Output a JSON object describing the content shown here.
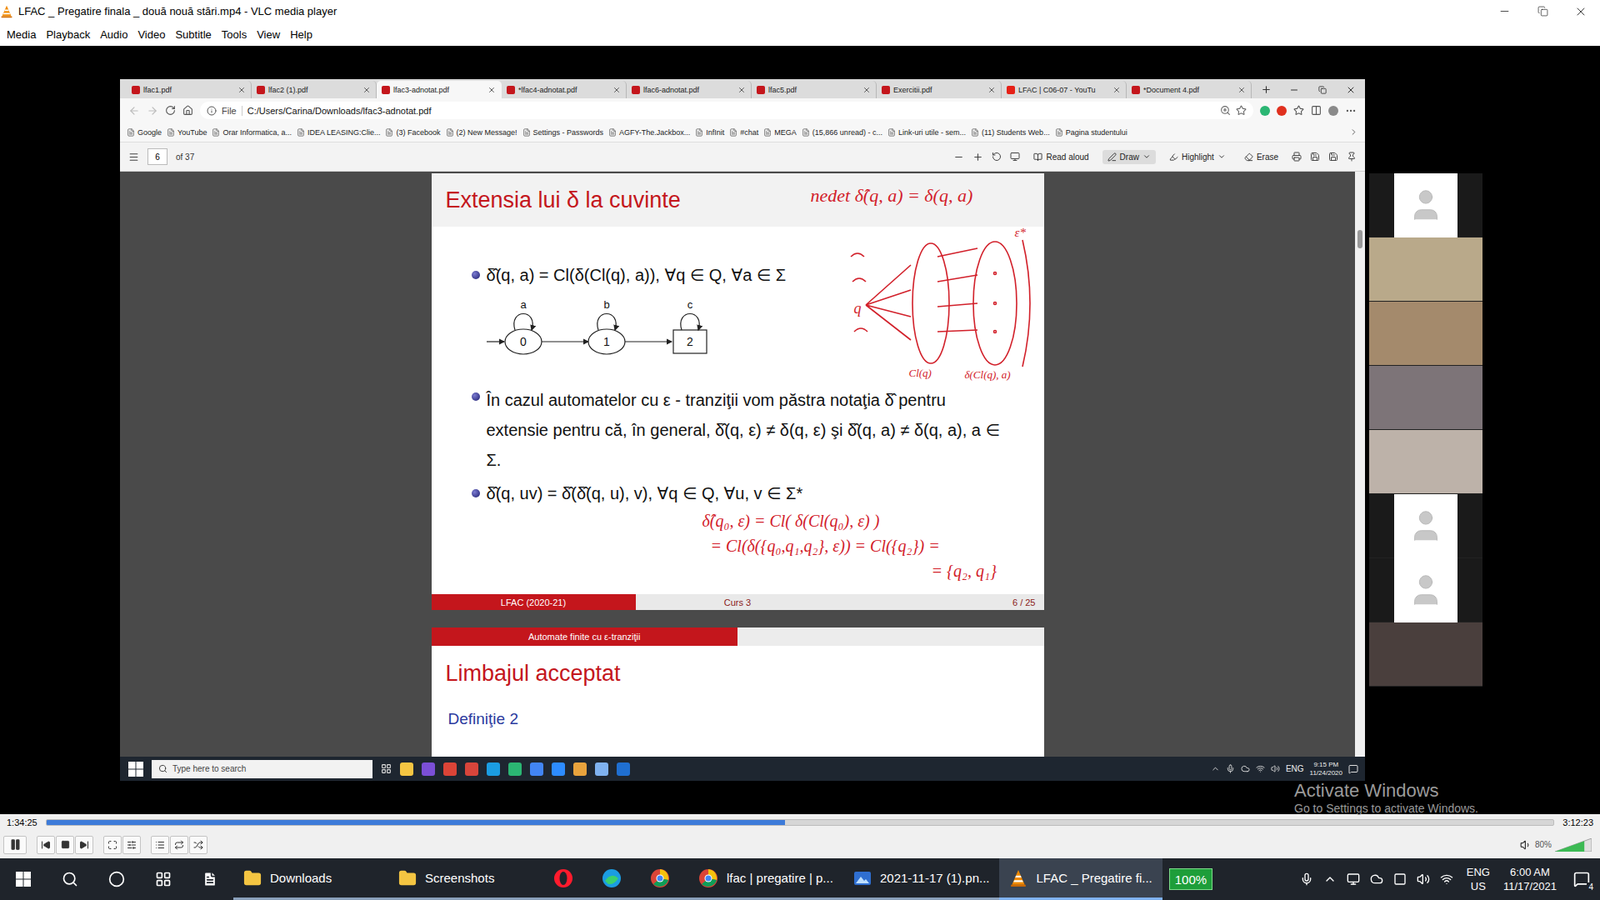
{
  "vlc": {
    "title": "LFAC _ Pregatire finala _ două nouă stări.mp4 - VLC media player",
    "menu": [
      "Media",
      "Playback",
      "Audio",
      "Video",
      "Subtitle",
      "Tools",
      "View",
      "Help"
    ]
  },
  "browser": {
    "tabs": [
      {
        "label": "lfac1.pdf",
        "kind": "pdf",
        "selected": false
      },
      {
        "label": "lfac2 (1).pdf",
        "kind": "pdf",
        "selected": false
      },
      {
        "label": "lfac3-adnotat.pdf",
        "kind": "pdf",
        "selected": true
      },
      {
        "label": "*lfac4-adnotat.pdf",
        "kind": "pdf",
        "selected": false
      },
      {
        "label": "lfac6-adnotat.pdf",
        "kind": "pdf",
        "selected": false
      },
      {
        "label": "lfac5.pdf",
        "kind": "pdf",
        "selected": false
      },
      {
        "label": "Exercitii.pdf",
        "kind": "pdf",
        "selected": false
      },
      {
        "label": "LFAC | C06-07 - YouTu",
        "kind": "youtube",
        "selected": false
      },
      {
        "label": "*Document 4.pdf",
        "kind": "pdf",
        "selected": false
      }
    ],
    "address": {
      "scheme": "File",
      "path": "C:/Users/Carina/Downloads/lfac3-adnotat.pdf"
    },
    "bookmarks": [
      "Google",
      "YouTube",
      "Orar Informatica, a...",
      "IDEA LEASING:Clie...",
      "(3) Facebook",
      "(2) New Message!",
      "Settings - Passwords",
      "AGFY-The.Jackbox...",
      "InfInit",
      "#chat",
      "MEGA",
      "(15,866 unread) - c...",
      "Link-uri utile - sem...",
      "(11) Students Web...",
      "Pagina studentului"
    ],
    "pdf_toolbar": {
      "page": "6",
      "of": "of 37",
      "tools": [
        {
          "label": "Read aloud",
          "kind": "read",
          "selected": false
        },
        {
          "label": "Draw",
          "kind": "draw",
          "selected": true
        },
        {
          "label": "Highlight",
          "kind": "highlight",
          "selected": false
        },
        {
          "label": "Erase",
          "kind": "erase",
          "selected": false
        }
      ]
    },
    "slide": {
      "title": "Extensia lui δ la cuvinte",
      "bullets": [
        {
          "text": "δ̂(q, a) = Cl(δ(Cl(q), a)), ∀q ∈ Q, ∀a ∈ Σ"
        },
        {
          "text": "În cazul automatelor cu ε - tranziţii vom păstra notaţia δ̂ pentru extensie pentru că, în general, δ̂(q, ε) ≠ δ(q, ε) şi δ̂(q, a) ≠ δ(q, a), a ∈ Σ."
        },
        {
          "text": "δ̂(q, uv) = δ̂(δ̂(q, u), v), ∀q ∈ Q, ∀u, v ∈ Σ*"
        }
      ],
      "diagram": {
        "states": [
          {
            "label": "0",
            "loop": "a",
            "kind": "normal"
          },
          {
            "label": "1",
            "loop": "b",
            "kind": "normal"
          },
          {
            "label": "2",
            "loop": "c",
            "kind": "final"
          }
        ]
      },
      "annotations": {
        "note": "nedet  δ̂(q, a) = δ(q, a)",
        "sketch_labels": [
          "q",
          "ε*",
          "Cl(q)",
          "δ(Cl(q), a)"
        ],
        "derivation": [
          "δ̂(q₀, ε) = Cl( δ(Cl(q₀), ε) )",
          "= Cl(δ({q₀,q₁,q₂}, ε)) = Cl({q₂}) =",
          "= {q₂, q₁}"
        ]
      },
      "footer": {
        "left": "LFAC (2020-21)",
        "center": "Curs 3",
        "right": "6 / 25"
      }
    },
    "next_slide": {
      "section": "Automate finite cu ε-tranziţii",
      "title": "Limbajul acceptat",
      "definition": "Definiţie 2"
    }
  },
  "inner_taskbar": {
    "search": "Type here to search",
    "lang": "ENG",
    "time": "9:15 PM",
    "date": "11/24/2020"
  },
  "participants": [
    {
      "kind": "avatar",
      "color": "#ffffff"
    },
    {
      "kind": "video",
      "color": "#b9a98a"
    },
    {
      "kind": "video",
      "color": "#a48a6c"
    },
    {
      "kind": "video",
      "color": "#7d7478"
    },
    {
      "kind": "video",
      "color": "#bdb2a9"
    },
    {
      "kind": "avatar",
      "color": "#ffffff"
    },
    {
      "kind": "avatar",
      "color": "#ffffff"
    },
    {
      "kind": "video",
      "color": "#4a3f3d"
    }
  ],
  "watermark": {
    "title": "Activate Windows",
    "subtitle": "Go to Settings to activate Windows."
  },
  "player": {
    "elapsed": "1:34:25",
    "total": "3:12:23",
    "level": 0.49,
    "volume": {
      "reading": "80%",
      "level": 0.8
    }
  },
  "taskbar": {
    "apps": [
      {
        "label": "Downloads",
        "kind": "folder",
        "active": false
      },
      {
        "label": "Screenshots",
        "kind": "folder",
        "active": false
      },
      {
        "label": "",
        "kind": "opera",
        "active": false
      },
      {
        "label": "",
        "kind": "edge",
        "active": false
      },
      {
        "label": "",
        "kind": "chrome",
        "active": false
      },
      {
        "label": "lfac | pregatire | p...",
        "kind": "chrome",
        "active": false
      },
      {
        "label": "2021-11-17 (1).pn...",
        "kind": "photo",
        "active": false
      },
      {
        "label": "LFAC _ Pregatire fi...",
        "kind": "vlc",
        "active": true
      }
    ],
    "battery": "100%",
    "lang": "ENG",
    "region": "US",
    "time": "6:00 AM",
    "date": "11/17/2021",
    "notifications": "4"
  }
}
